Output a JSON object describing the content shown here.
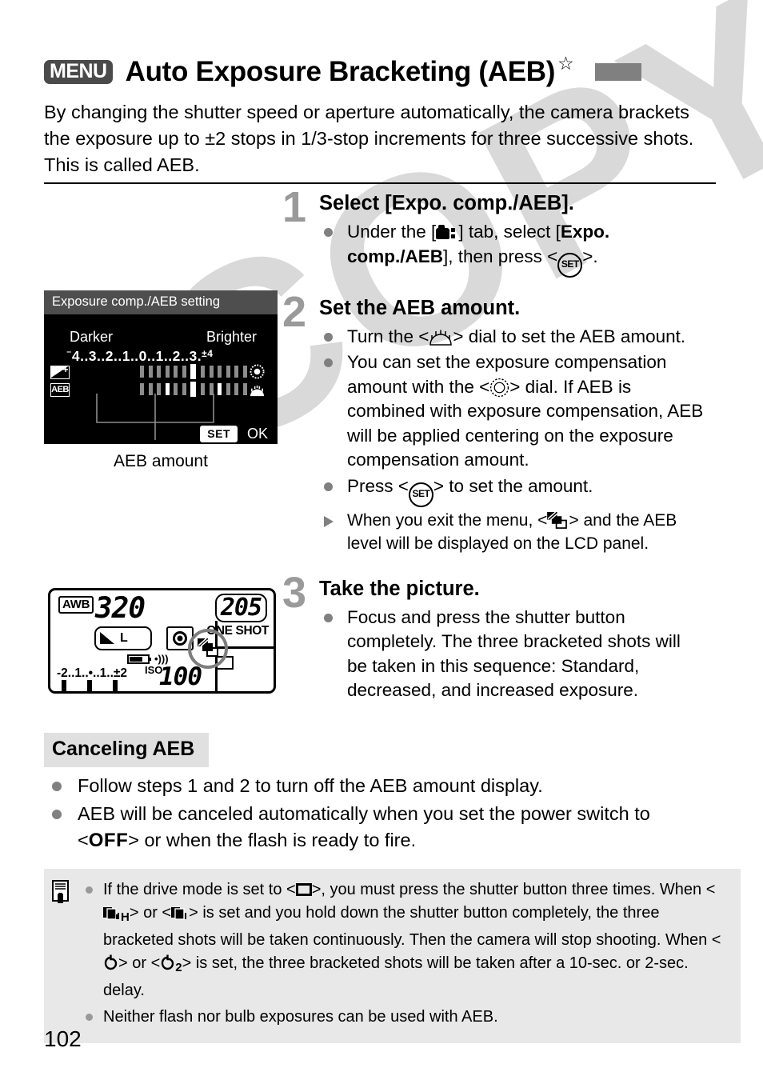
{
  "header": {
    "menu_badge": "MENU",
    "title": "Auto Exposure Bracketing (AEB)",
    "star_icon": "☆",
    "tab_marker_color": "#808080"
  },
  "intro": "By changing the shutter speed or aperture automatically, the camera brackets the exposure up to ±2 stops in 1/3-stop increments for three successive shots. This is called AEB.",
  "lcd_menu": {
    "title": "Exposure comp./AEB setting",
    "darker_label": "Darker",
    "brighter_label": "Brighter",
    "scale_minus": "⁻",
    "scale_numbers": "4..3..2..1..0..1..2..3.",
    "scale_plus": "±4",
    "row1_icon": "exposure-compensation-icon",
    "row2_icon": "AEB",
    "quick_dial_icon": "quick-control-dial-icon",
    "main_dial_icon": "main-dial-icon",
    "set_badge": "SET",
    "ok_label": "OK",
    "caption": "AEB amount"
  },
  "lcd_panel": {
    "awb": "AWB",
    "shutter_speed": "320",
    "aperture": "205",
    "quality_label": "L",
    "af_mode": "ONE SHOT",
    "iso_label": "ISO",
    "iso_value": "100",
    "exposure_scale": "-2..1..•..1..±2",
    "metering_icon": "metering-mode-icon",
    "battery_icon": "battery-icon",
    "beep_icon": "beep-icon",
    "drive_icon": "single-shooting-icon",
    "aeb_icon": "aeb-icon",
    "highlight_circle": "aeb-icon-highlight-circle"
  },
  "steps": [
    {
      "number": "1",
      "title": "Select [Expo. comp./AEB].",
      "bullets": [
        {
          "type": "dot",
          "parts": [
            {
              "t": "text",
              "v": "Under the ["
            },
            {
              "t": "icon",
              "v": "shooting-menu-tab-icon"
            },
            {
              "t": "text",
              "v": "] tab, select ["
            },
            {
              "t": "bold",
              "v": "Expo. comp./AEB"
            },
            {
              "t": "text",
              "v": "], then press <"
            },
            {
              "t": "icon",
              "v": "set-button-icon"
            },
            {
              "t": "text",
              "v": ">."
            }
          ]
        }
      ]
    },
    {
      "number": "2",
      "title": "Set the AEB amount.",
      "bullets": [
        {
          "type": "dot",
          "parts": [
            {
              "t": "text",
              "v": "Turn the <"
            },
            {
              "t": "icon",
              "v": "main-dial-icon"
            },
            {
              "t": "text",
              "v": "> dial to set the AEB amount."
            }
          ]
        },
        {
          "type": "dot",
          "parts": [
            {
              "t": "text",
              "v": "You can set the exposure compensation amount with the <"
            },
            {
              "t": "icon",
              "v": "quick-control-dial-icon"
            },
            {
              "t": "text",
              "v": "> dial. If AEB is combined with exposure compensation, AEB will be applied centering on the exposure compensation amount."
            }
          ]
        },
        {
          "type": "dot",
          "parts": [
            {
              "t": "text",
              "v": "Press <"
            },
            {
              "t": "icon",
              "v": "set-button-icon"
            },
            {
              "t": "text",
              "v": "> to set the amount."
            }
          ]
        },
        {
          "type": "arrow",
          "small": true,
          "parts": [
            {
              "t": "text",
              "v": "When you exit the menu, <"
            },
            {
              "t": "icon",
              "v": "aeb-icon"
            },
            {
              "t": "text",
              "v": "> and the AEB level will be displayed on the LCD panel."
            }
          ]
        }
      ]
    },
    {
      "number": "3",
      "title": "Take the picture.",
      "bullets": [
        {
          "type": "dot",
          "parts": [
            {
              "t": "text",
              "v": "Focus and press the shutter button completely. The three bracketed shots will be taken in this sequence: Standard, decreased, and increased exposure."
            }
          ]
        }
      ]
    }
  ],
  "canceling": {
    "heading": "Canceling AEB",
    "items": [
      {
        "parts": [
          {
            "t": "text",
            "v": "Follow steps 1 and 2 to turn off the AEB amount display."
          }
        ]
      },
      {
        "parts": [
          {
            "t": "text",
            "v": "AEB will be canceled automatically when you set the power switch to <"
          },
          {
            "t": "off",
            "v": "OFF"
          },
          {
            "t": "text",
            "v": "> or when the flash is ready to fire."
          }
        ]
      }
    ]
  },
  "note": {
    "icon": "note-pencil-icon",
    "items": [
      {
        "parts": [
          {
            "t": "text",
            "v": "If the drive mode is set to <"
          },
          {
            "t": "icon",
            "v": "single-shooting-icon"
          },
          {
            "t": "text",
            "v": ">, you must press the shutter button three times. When <"
          },
          {
            "t": "icon",
            "v": "high-speed-continuous-icon"
          },
          {
            "t": "text",
            "v": "> or <"
          },
          {
            "t": "icon",
            "v": "continuous-shooting-icon"
          },
          {
            "t": "text",
            "v": "> is set and you hold down the shutter button completely, the three bracketed shots will be taken continuously. Then the camera will stop shooting. When <"
          },
          {
            "t": "icon",
            "v": "self-timer-10sec-icon"
          },
          {
            "t": "text",
            "v": "> or <"
          },
          {
            "t": "icon",
            "v": "self-timer-2sec-icon"
          },
          {
            "t": "text",
            "v": "> is set, the three bracketed shots will be taken after a 10-sec. or 2-sec. delay."
          }
        ]
      },
      {
        "parts": [
          {
            "t": "text",
            "v": "Neither flash nor bulb exposures can be used with AEB."
          }
        ]
      }
    ]
  },
  "watermark": "COPY",
  "page_number": "102"
}
